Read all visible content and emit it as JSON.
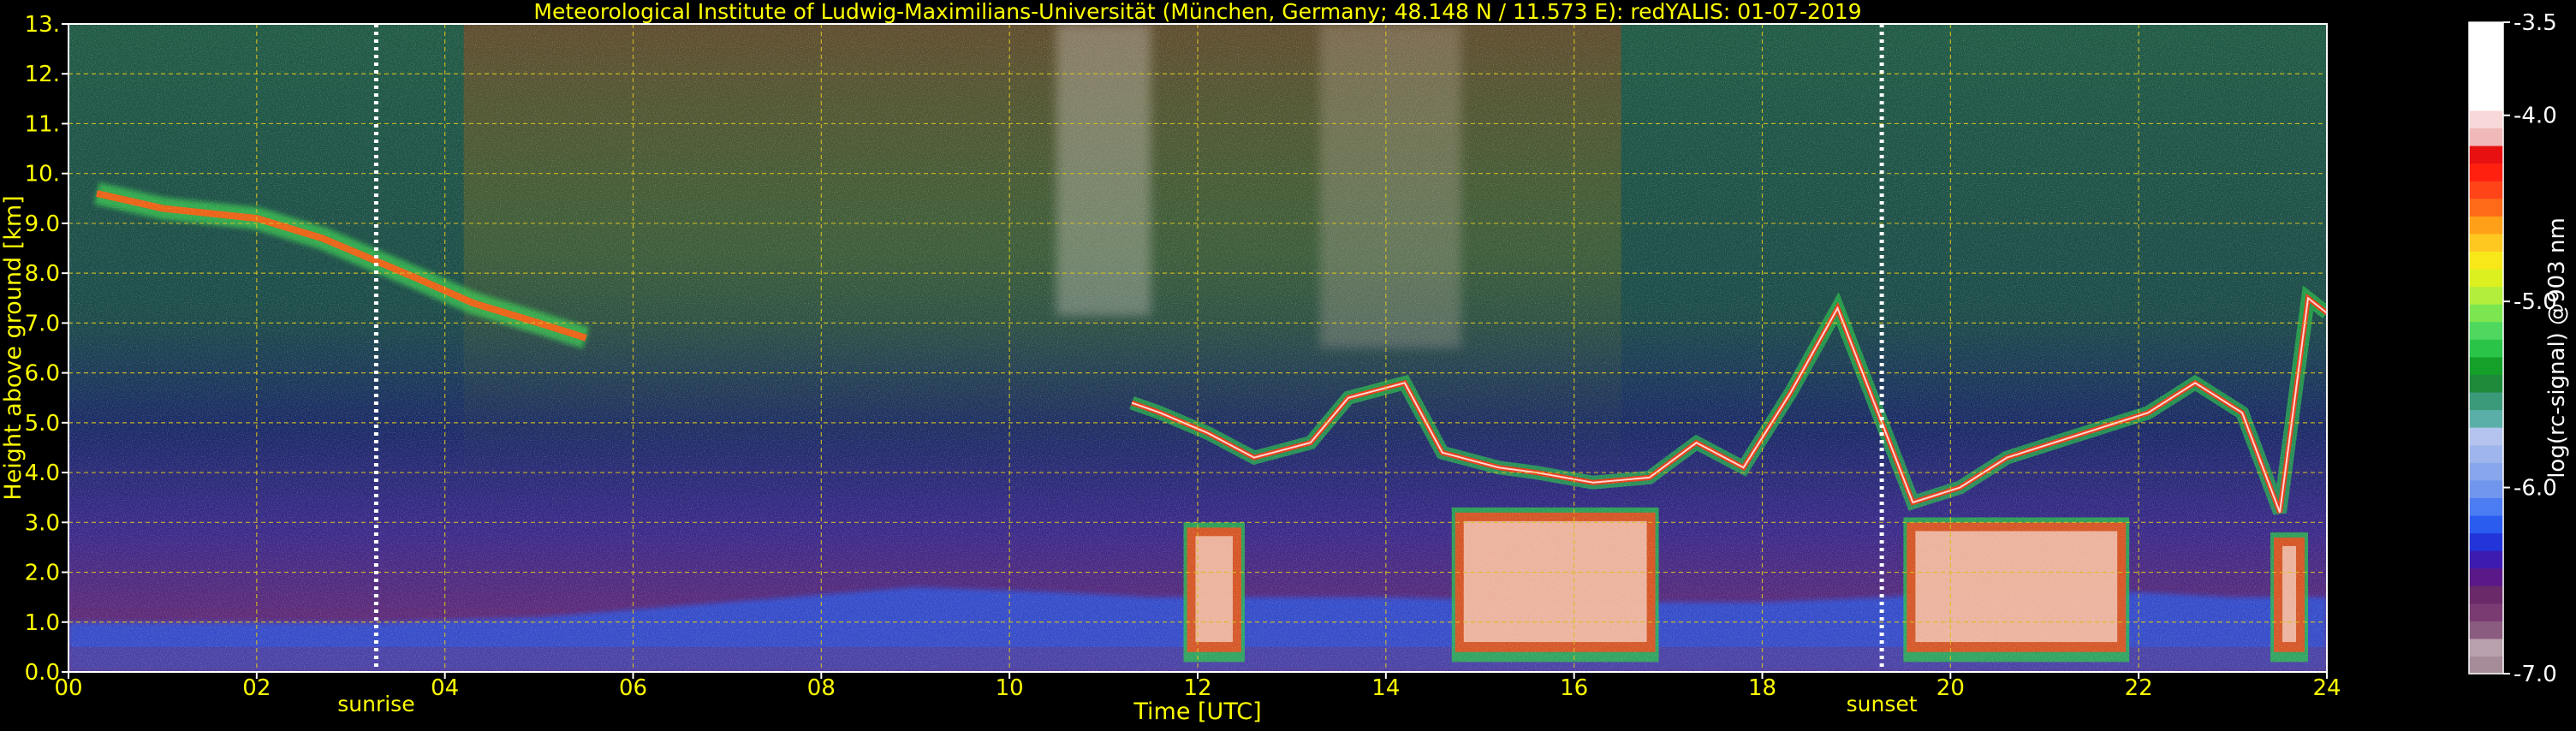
{
  "colors": {
    "background": "#000000",
    "text_yellow": "#ffff00",
    "text_white": "#ffffff",
    "grid": "#d8c020",
    "sun_line": "#ffffff"
  },
  "chart_data": {
    "type": "heatmap",
    "title": "Meteorological Institute of Ludwig-Maximilians-Universität (München, Germany; 48.148 N / 11.573 E):    redYALIS: 01-07-2019",
    "xlabel": "Time [UTC]",
    "ylabel": "Height above ground [km]",
    "xlim": [
      0,
      24
    ],
    "ylim": [
      0,
      13
    ],
    "grid": true,
    "x_ticks": [
      {
        "value": 0,
        "label": "00"
      },
      {
        "value": 2,
        "label": "02"
      },
      {
        "value": 4,
        "label": "04"
      },
      {
        "value": 6,
        "label": "06"
      },
      {
        "value": 8,
        "label": "08"
      },
      {
        "value": 10,
        "label": "10"
      },
      {
        "value": 12,
        "label": "12"
      },
      {
        "value": 14,
        "label": "14"
      },
      {
        "value": 16,
        "label": "16"
      },
      {
        "value": 18,
        "label": "18"
      },
      {
        "value": 20,
        "label": "20"
      },
      {
        "value": 22,
        "label": "22"
      },
      {
        "value": 24,
        "label": "24"
      }
    ],
    "y_ticks": [
      {
        "value": 0,
        "label": "0.0"
      },
      {
        "value": 1,
        "label": "1.0"
      },
      {
        "value": 2,
        "label": "2.0"
      },
      {
        "value": 3,
        "label": "3.0"
      },
      {
        "value": 4,
        "label": "4.0"
      },
      {
        "value": 5,
        "label": "5.0"
      },
      {
        "value": 6,
        "label": "6.0"
      },
      {
        "value": 7,
        "label": "7.0"
      },
      {
        "value": 8,
        "label": "8.0"
      },
      {
        "value": 9,
        "label": "9.0"
      },
      {
        "value": 10,
        "label": "10."
      },
      {
        "value": 11,
        "label": "11."
      },
      {
        "value": 12,
        "label": "12."
      },
      {
        "value": 13,
        "label": "13."
      }
    ],
    "annotations": [
      {
        "text": "sunrise",
        "time": 3.27
      },
      {
        "text": "sunset",
        "time": 19.27
      }
    ],
    "colorbar": {
      "label": "log(rc-signal) @903 nm",
      "range": [
        -7.0,
        -3.5
      ],
      "ticks": [
        {
          "value": -3.5,
          "label": "-3.5"
        },
        {
          "value": -4.0,
          "label": "-4.0"
        },
        {
          "value": -5.0,
          "label": "-5.0"
        },
        {
          "value": -6.0,
          "label": "-6.0"
        },
        {
          "value": -7.0,
          "label": "-7.0"
        }
      ],
      "colors": [
        "#a68c99",
        "#b8a1ad",
        "#8a5c7f",
        "#7a3a72",
        "#6a2a6a",
        "#5a1888",
        "#3d1ab0",
        "#2235d8",
        "#2a5cf0",
        "#4c7cf2",
        "#7096ee",
        "#88a6ec",
        "#9fb6ec",
        "#b4c4ee",
        "#5ab0a8",
        "#3a9a7a",
        "#1e8a3a",
        "#15a02a",
        "#2ac448",
        "#4ed860",
        "#7ce650",
        "#b4ee3c",
        "#dcf020",
        "#f8e81a",
        "#ffc820",
        "#ffa018",
        "#ff6a18",
        "#ff4418",
        "#ff2010",
        "#e81010",
        "#f0b8b8",
        "#f8d8d8",
        "#ffffff",
        "#ffffff",
        "#ffffff",
        "#ffffff",
        "#ffffff"
      ]
    },
    "features": {
      "boundary_layer": [
        [
          0,
          1.0
        ],
        [
          2,
          1.0
        ],
        [
          3.3,
          1.0
        ],
        [
          5,
          1.1
        ],
        [
          7,
          1.4
        ],
        [
          9,
          1.7
        ],
        [
          10.5,
          1.6
        ],
        [
          11.5,
          1.5
        ],
        [
          12,
          1.5
        ],
        [
          14,
          1.5
        ],
        [
          16,
          1.4
        ],
        [
          18,
          1.4
        ],
        [
          19.3,
          1.5
        ],
        [
          20,
          1.6
        ],
        [
          22,
          1.6
        ],
        [
          23,
          1.5
        ],
        [
          24,
          1.5
        ]
      ],
      "cirrus": [
        [
          0.3,
          9.6
        ],
        [
          1,
          9.3
        ],
        [
          2,
          9.1
        ],
        [
          2.7,
          8.7
        ],
        [
          3.2,
          8.3
        ],
        [
          3.7,
          7.9
        ],
        [
          4.3,
          7.4
        ],
        [
          5,
          7.0
        ],
        [
          5.5,
          6.7
        ]
      ],
      "cloud_top": [
        [
          11.3,
          5.4
        ],
        [
          11.6,
          5.2
        ],
        [
          12.1,
          4.8
        ],
        [
          12.6,
          4.3
        ],
        [
          13.2,
          4.6
        ],
        [
          13.6,
          5.5
        ],
        [
          14.2,
          5.8
        ],
        [
          14.6,
          4.4
        ],
        [
          15.2,
          4.1
        ],
        [
          15.6,
          4.0
        ],
        [
          16.2,
          3.8
        ],
        [
          16.8,
          3.9
        ],
        [
          17.3,
          4.6
        ],
        [
          17.8,
          4.1
        ],
        [
          18.3,
          5.6
        ],
        [
          18.8,
          7.3
        ],
        [
          19.6,
          3.4
        ],
        [
          20.1,
          3.7
        ],
        [
          20.6,
          4.3
        ],
        [
          21.1,
          4.6
        ],
        [
          21.6,
          4.9
        ],
        [
          22.1,
          5.2
        ],
        [
          22.6,
          5.8
        ],
        [
          23.1,
          5.2
        ],
        [
          23.5,
          3.2
        ],
        [
          23.8,
          7.5
        ],
        [
          24,
          7.2
        ]
      ],
      "convective_columns": [
        [
          11.85,
          12.5,
          3.0
        ],
        [
          14.7,
          16.9,
          3.3
        ],
        [
          19.5,
          21.9,
          3.1
        ],
        [
          23.4,
          23.8,
          2.8
        ]
      ]
    }
  }
}
